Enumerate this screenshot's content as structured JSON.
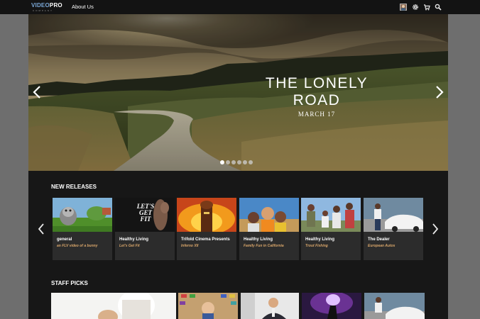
{
  "header": {
    "logo_main": "VIDEO PRO",
    "logo_sub": "COMPANY",
    "nav": [
      {
        "label": "About Us"
      }
    ],
    "icons": [
      "user-avatar-icon",
      "gear-icon",
      "cart-icon",
      "search-icon"
    ]
  },
  "hero": {
    "title_line1": "THE LONELY",
    "title_line2": "ROAD",
    "date": "MARCH 17",
    "slide_count": 6,
    "active_slide": 0
  },
  "new_releases": {
    "heading": "NEW RELEASES",
    "items": [
      {
        "title": "general",
        "subtitle": "an FLV video of a bunny"
      },
      {
        "title": "Healthy Living",
        "subtitle": "Let's Get Fit"
      },
      {
        "title": "Trifold Cinema Presents",
        "subtitle": "Inferno XII"
      },
      {
        "title": "Healthy Living",
        "subtitle": "Family Fun in California"
      },
      {
        "title": "Healthy Living",
        "subtitle": "Trout Fishing"
      },
      {
        "title": "The Dealer",
        "subtitle": "European Autos"
      }
    ]
  },
  "staff_picks": {
    "heading": "STAFF PICKS"
  },
  "thumb_text": {
    "fit_line1": "LET'S",
    "fit_line2": "GET",
    "fit_line3": "FIT"
  },
  "colors": {
    "topbar": "#131313",
    "page_bg": "#171717",
    "card_bg": "#2c2c2c",
    "subtitle_accent": "#d9a66a",
    "outer_bg": "#6e6e6e"
  }
}
